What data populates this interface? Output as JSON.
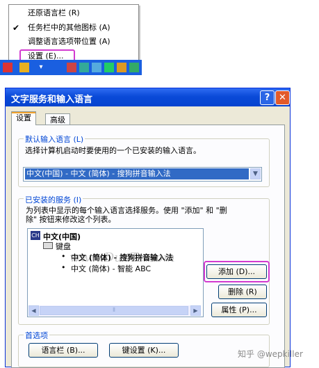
{
  "context_menu": {
    "items": [
      {
        "label": "还原语言栏 (R)",
        "checked": false
      },
      {
        "label": "任务栏中的其他图标 (A)",
        "checked": true
      },
      {
        "label": "调整语言选项带位置 (A)",
        "checked": false
      },
      {
        "label": "设置 (E)...",
        "checked": false,
        "highlighted": true
      }
    ],
    "check_glyph": "✔"
  },
  "dialog": {
    "title": "文字服务和输入语言",
    "help_button": "?",
    "close_button": "✕",
    "tabs": [
      {
        "label": "设置",
        "active": true
      },
      {
        "label": "高级",
        "active": false
      }
    ],
    "default_language": {
      "group_title": "默认输入语言 (L)",
      "description": "选择计算机启动时要使用的一个已安装的输入语言。",
      "selected": "中文(中国) - 中文 (简体) - 搜狗拼音输入法"
    },
    "installed_services": {
      "group_title": "已安装的服务 (I)",
      "description_line1": "为列表中显示的每个输入语言选择服务。使用 \"添加\" 和 \"删",
      "description_line2": "除\" 按钮来修改这个列表。",
      "tree": {
        "language_badge": "CH",
        "language": "中文(中国)",
        "category": "键盘",
        "items": [
          {
            "label": "中文 (简体) - 搜狗拼音输入法",
            "bold": true
          },
          {
            "label": "中文 (简体) - 智能 ABC",
            "bold": false
          }
        ]
      },
      "buttons": {
        "add": "添加 (D)...",
        "remove": "删除 (R)",
        "properties": "属性 (P)..."
      }
    },
    "preferences": {
      "group_title": "首选项",
      "language_bar_button": "语言栏 (B)...",
      "key_settings_button": "键设置 (K)..."
    }
  },
  "watermark": "www.DuoTe.com",
  "corner_credit": "知乎 @wepkiller",
  "colors": {
    "title_bar": "#0a4ad8",
    "highlight_outline": "#d23ad0",
    "group_title": "#0046d5",
    "selection": "#316ac5",
    "taskbar": "#1a5fe0"
  }
}
